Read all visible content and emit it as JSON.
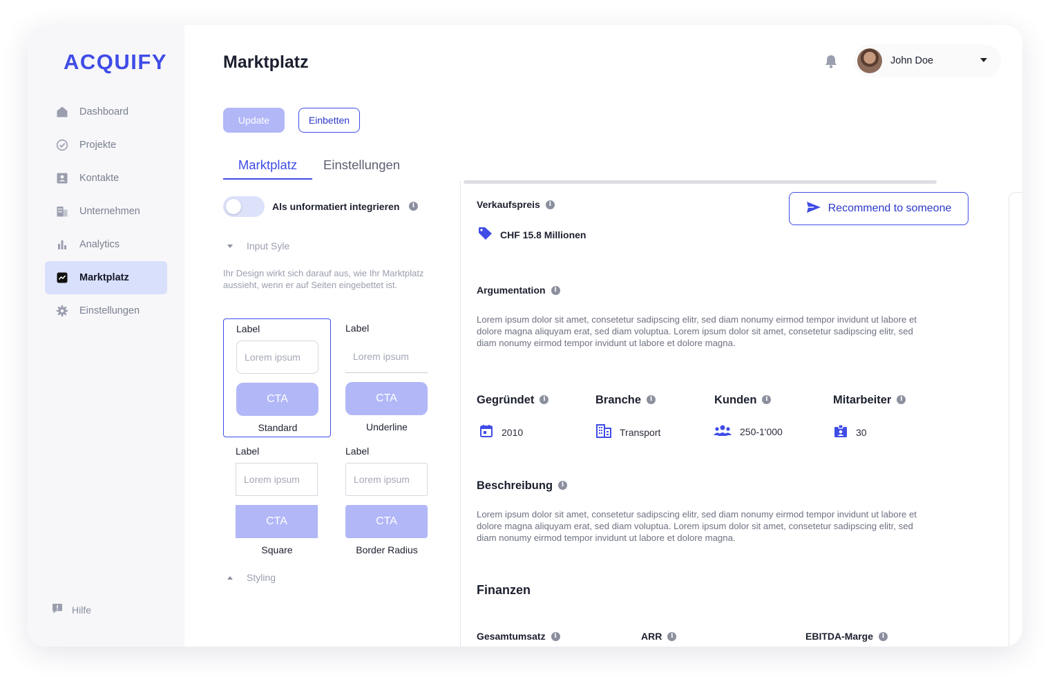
{
  "brand": {
    "logo": "ACQUIFY",
    "accent": "#3f4ce6"
  },
  "sidebar": {
    "items": [
      {
        "label": "Dashboard",
        "icon": "home-icon"
      },
      {
        "label": "Projekte",
        "icon": "check-circle-icon"
      },
      {
        "label": "Kontakte",
        "icon": "contact-card-icon"
      },
      {
        "label": "Unternehmen",
        "icon": "building-icon"
      },
      {
        "label": "Analytics",
        "icon": "bar-chart-icon"
      },
      {
        "label": "Marktplatz",
        "icon": "trend-icon",
        "active": true
      },
      {
        "label": "Einstellungen",
        "icon": "gear-icon"
      }
    ],
    "help": "Hilfe"
  },
  "header": {
    "title": "Marktplatz",
    "user": {
      "name": "John Doe"
    }
  },
  "toolbar": {
    "update": "Update",
    "embed": "Einbetten"
  },
  "tabs": [
    {
      "label": "Marktplatz",
      "active": true
    },
    {
      "label": "Einstellungen"
    }
  ],
  "settings": {
    "toggle_label": "Als unformatiert integrieren",
    "toggle_on": false,
    "input_style_label": "Input Syle",
    "description": "Ihr Design wirkt sich darauf aus, wie Ihr Marktplatz aussieht, wenn er auf Seiten eingebettet ist.",
    "styles": [
      {
        "label": "Label",
        "placeholder": "Lorem ipsum",
        "cta": "CTA",
        "name": "Standard",
        "selected": true
      },
      {
        "label": "Label",
        "placeholder": "Lorem ipsum",
        "cta": "CTA",
        "name": "Underline"
      },
      {
        "label": "Label",
        "placeholder": "Lorem ipsum",
        "cta": "CTA",
        "name": "Square"
      },
      {
        "label": "Label",
        "placeholder": "Lorem ipsum",
        "cta": "CTA",
        "name": "Border Radius"
      }
    ],
    "styling_label": "Styling"
  },
  "listing": {
    "price_label": "Verkaufspreis",
    "price": "CHF 15.8 Millionen",
    "recommend": "Recommend to someone",
    "argumentation_label": "Argumentation",
    "argumentation_text": "Lorem ipsum dolor sit amet, consetetur sadipscing elitr, sed diam nonumy eirmod tempor invidunt ut labore et dolore magna aliquyam erat, sed diam voluptua. Lorem ipsum dolor sit amet, consetetur sadipscing elitr, sed diam nonumy eirmod tempor invidunt ut labore et dolore magna.",
    "stats": [
      {
        "label": "Gegründet",
        "value": "2010",
        "icon": "calendar-icon"
      },
      {
        "label": "Branche",
        "value": "Transport",
        "icon": "building-icon"
      },
      {
        "label": "Kunden",
        "value": "250-1'000",
        "icon": "people-icon"
      },
      {
        "label": "Mitarbeiter",
        "value": "30",
        "icon": "id-badge-icon"
      }
    ],
    "description_label": "Beschreibung",
    "description_text": "Lorem ipsum dolor sit amet, consetetur sadipscing elitr, sed diam nonumy eirmod tempor invidunt ut labore et dolore magna aliquyam erat, sed diam voluptua. Lorem ipsum dolor sit amet, consetetur sadipscing elitr, sed diam nonumy eirmod tempor invidunt ut labore et dolore magna.",
    "finance_title": "Finanzen",
    "finance_fields": [
      "Gesamtumsatz",
      "ARR",
      "EBITDA-Marge"
    ]
  }
}
